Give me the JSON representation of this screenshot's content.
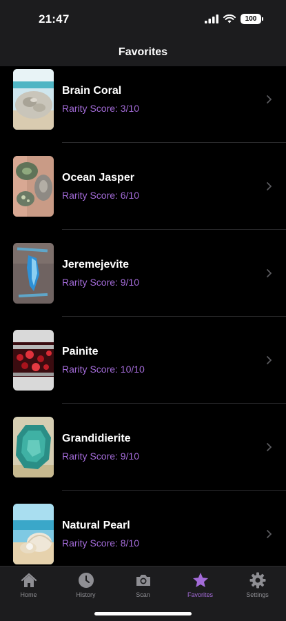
{
  "status_bar": {
    "time": "21:47",
    "battery": "100"
  },
  "nav": {
    "title": "Favorites"
  },
  "items": [
    {
      "name": "Brain Coral",
      "score": "Rarity Score: 3/10"
    },
    {
      "name": "Ocean Jasper",
      "score": "Rarity Score: 6/10"
    },
    {
      "name": "Jeremejevite",
      "score": "Rarity Score: 9/10"
    },
    {
      "name": "Painite",
      "score": "Rarity Score: 10/10"
    },
    {
      "name": "Grandidierite",
      "score": "Rarity Score: 9/10"
    },
    {
      "name": "Natural Pearl",
      "score": "Rarity Score: 8/10"
    }
  ],
  "tabs": [
    {
      "label": "Home",
      "icon": "home-icon"
    },
    {
      "label": "History",
      "icon": "clock-icon"
    },
    {
      "label": "Scan",
      "icon": "camera-icon"
    },
    {
      "label": "Favorites",
      "icon": "star-icon",
      "active": true
    },
    {
      "label": "Settings",
      "icon": "gear-icon"
    }
  ],
  "colors": {
    "accent": "#a36bd8",
    "background": "#000000",
    "bar": "#1c1c1e",
    "inactive": "#8e8e93"
  }
}
